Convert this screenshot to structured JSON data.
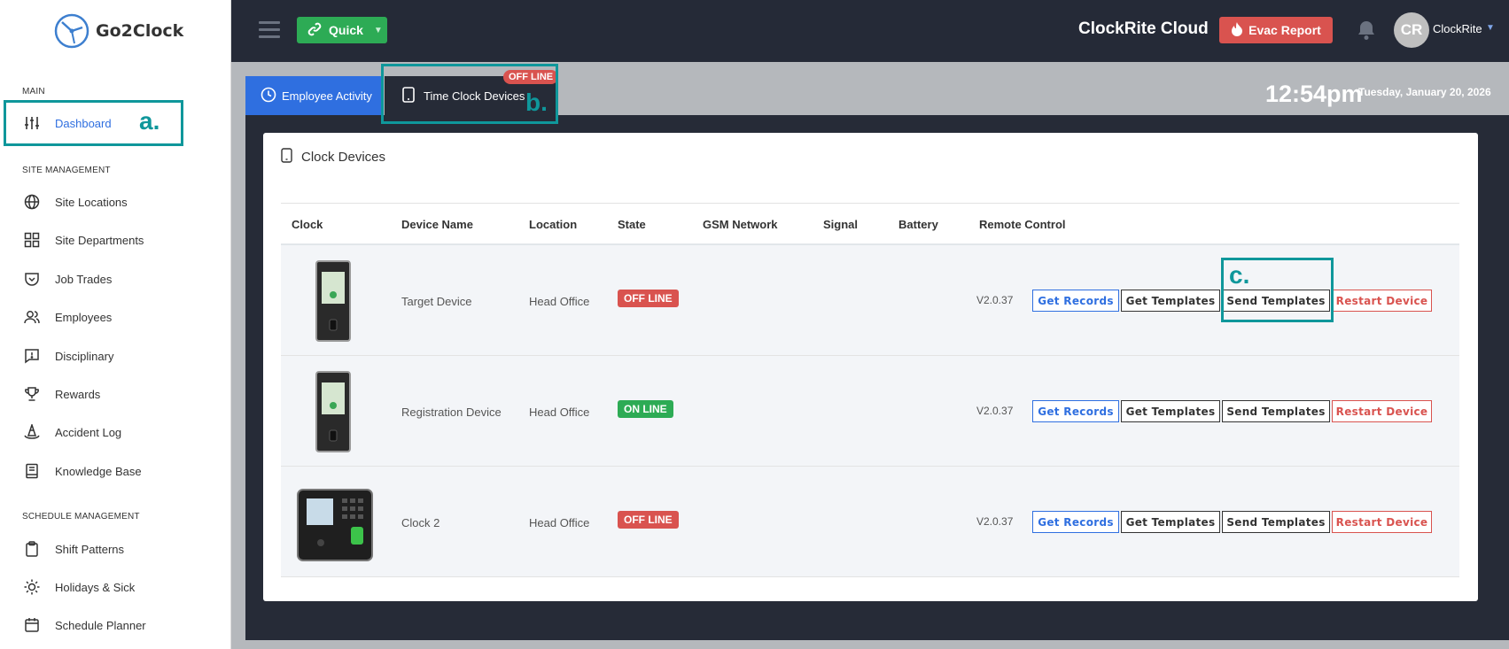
{
  "app": {
    "name": "Go2Clock",
    "brand": "ClockRite Cloud"
  },
  "sidebar": {
    "sections": [
      "MAIN",
      "SITE MANAGEMENT",
      "SCHEDULE MANAGEMENT"
    ],
    "items": [
      {
        "label": "Dashboard",
        "icon": "sliders-icon",
        "active": true
      },
      {
        "label": "Site Locations",
        "icon": "globe-icon"
      },
      {
        "label": "Site Departments",
        "icon": "grid-icon"
      },
      {
        "label": "Job Trades",
        "icon": "shield-icon"
      },
      {
        "label": "Employees",
        "icon": "users-icon"
      },
      {
        "label": "Disciplinary",
        "icon": "alert-message-icon"
      },
      {
        "label": "Rewards",
        "icon": "trophy-icon"
      },
      {
        "label": "Accident Log",
        "icon": "cone-icon"
      },
      {
        "label": "Knowledge Base",
        "icon": "book-icon"
      },
      {
        "label": "Shift Patterns",
        "icon": "clipboard-icon"
      },
      {
        "label": "Holidays & Sick",
        "icon": "sun-icon"
      },
      {
        "label": "Schedule Planner",
        "icon": "calendar-icon"
      }
    ]
  },
  "topbar": {
    "quick_label": "Quick",
    "evac_label": "Evac Report",
    "avatar_initials": "CR",
    "username": "ClockRite"
  },
  "tabs": {
    "employee_activity": "Employee Activity",
    "time_clock_devices": "Time Clock Devices",
    "offline_badge": "OFF LINE"
  },
  "clock": {
    "time": "12:54pm",
    "date": "Tuesday, January 20, 2026"
  },
  "card": {
    "title": "Clock Devices"
  },
  "table": {
    "headers": [
      "Clock",
      "Device Name",
      "Location",
      "State",
      "GSM Network",
      "Signal",
      "Battery",
      "Remote Control"
    ],
    "rows": [
      {
        "device_name": "Target Device",
        "location": "Head Office",
        "state": "OFF LINE",
        "version": "V2.0.37"
      },
      {
        "device_name": "Registration Device",
        "location": "Head Office",
        "state": "ON LINE",
        "version": "V2.0.37"
      },
      {
        "device_name": "Clock 2",
        "location": "Head Office",
        "state": "OFF LINE",
        "version": "V2.0.37"
      }
    ],
    "buttons": {
      "get_records": "Get Records",
      "get_templates": "Get Templates",
      "send_templates": "Send Templates",
      "restart_device": "Restart Device"
    }
  },
  "annotations": {
    "a": "a.",
    "b": "b.",
    "c": "c."
  },
  "colors": {
    "accent": "#2f6fe0",
    "success": "#2dab55",
    "danger": "#d9534f",
    "highlight": "#0f979b",
    "topbar": "#252a37"
  }
}
